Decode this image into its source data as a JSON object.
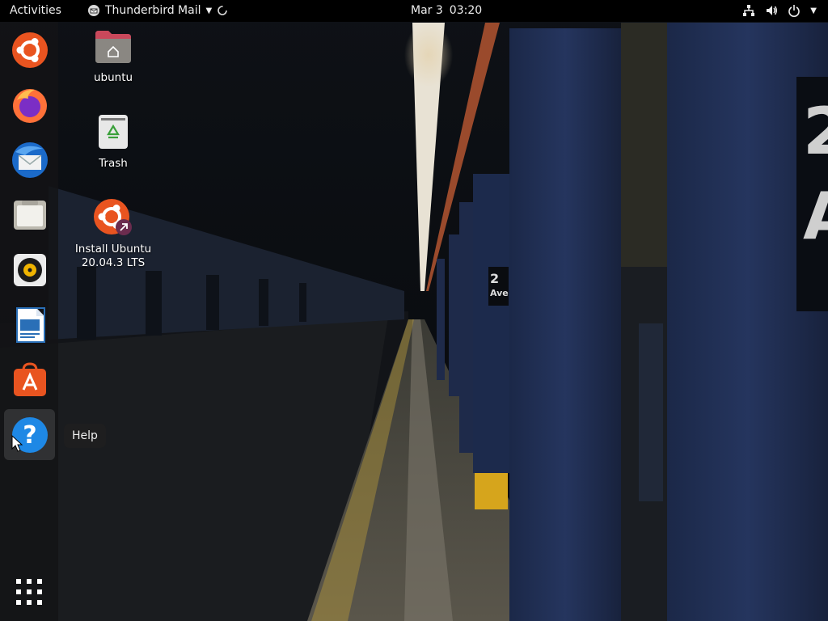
{
  "topbar": {
    "activities": "Activities",
    "app_name": "Thunderbird Mail",
    "date": "Mar 3",
    "time": "03:20",
    "icons": [
      "network-icon",
      "volume-icon",
      "power-icon",
      "system-menu-caret-icon"
    ]
  },
  "dock": {
    "items": [
      {
        "name": "Ubuntu Software Center Ubuntu",
        "icon": "ubuntu-logo-icon"
      },
      {
        "name": "Firefox",
        "icon": "firefox-icon"
      },
      {
        "name": "Thunderbird",
        "icon": "thunderbird-icon"
      },
      {
        "name": "Files",
        "icon": "files-icon"
      },
      {
        "name": "Rhythmbox",
        "icon": "rhythmbox-icon"
      },
      {
        "name": "LibreOffice Writer",
        "icon": "writer-icon"
      },
      {
        "name": "Ubuntu Software",
        "icon": "software-icon"
      },
      {
        "name": "Help",
        "icon": "help-icon"
      }
    ],
    "show_apps_icon": "app-grid-icon"
  },
  "desktop": {
    "icons": [
      {
        "label": "ubuntu",
        "icon": "home-folder-icon"
      },
      {
        "label": "Trash",
        "icon": "trash-icon"
      },
      {
        "label_line1": "Install Ubuntu",
        "label_line2": "20.04.3 LTS",
        "icon": "installer-icon"
      }
    ]
  },
  "tooltip": {
    "text": "Help"
  },
  "colors": {
    "topbar_bg": "#000000",
    "dock_bg": "#141416",
    "ubuntu_orange": "#E95420",
    "help_blue": "#1E88E5"
  }
}
